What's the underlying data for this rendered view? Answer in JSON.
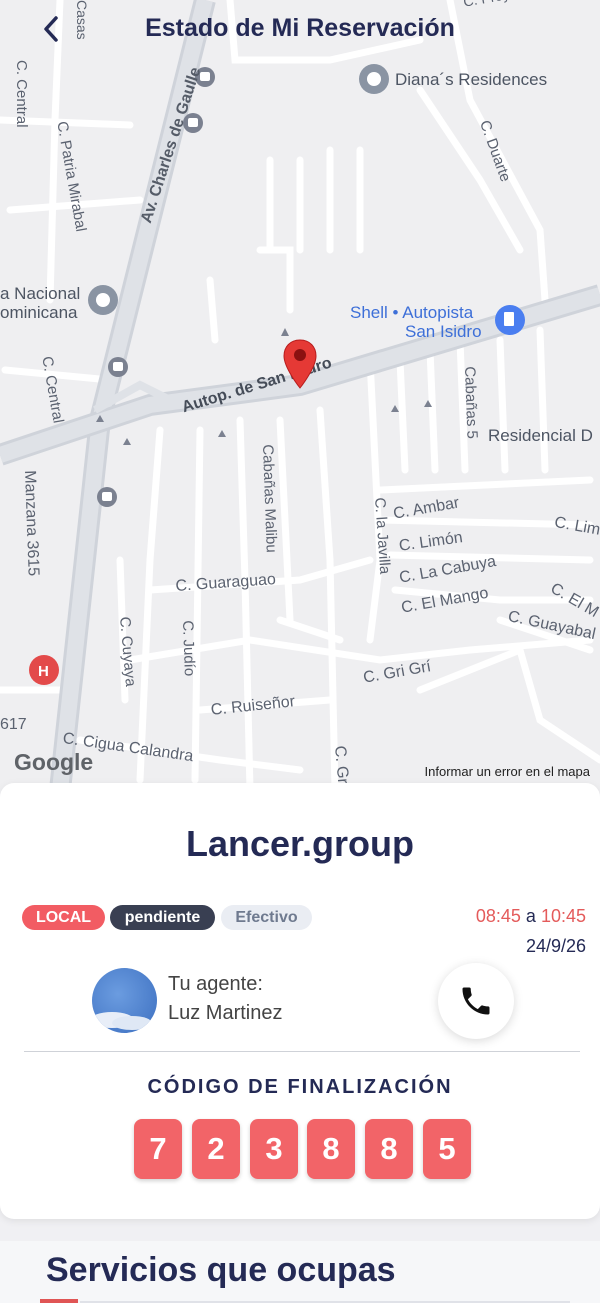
{
  "header": {
    "title": "Estado de Mi Reservación",
    "back_icon": "chevron-left-icon"
  },
  "map": {
    "streets": [
      "Av. Charles de Gaulle",
      "Autop. de San Isidro",
      "C. Central",
      "C. Patria Mirabal",
      "C. Duarte",
      "C. Central",
      "Manzana 3615",
      "Cabañas Malibu",
      "Cabañas 5",
      "C. la Javilla",
      "C. Ambar",
      "C. Limón",
      "C. La Cabuya",
      "C. El Mango",
      "C. Guayabal",
      "C. Guaraguao",
      "C. Cuyaya",
      "C. Judío",
      "C. Gri Grí",
      "C. Ruiseñor",
      "C. Cigua Calandra",
      "C. Lim",
      "C. El M",
      "C. Gr",
      "617",
      "Casas",
      "C. Proyecto"
    ],
    "places": [
      {
        "name": "Diana´s Residences",
        "icon": "poi-pin-icon"
      },
      {
        "name": "a Nacional",
        "icon": "poi-pin-icon"
      },
      {
        "name": "ominicana",
        "icon": ""
      },
      {
        "name": "Shell • Autopista",
        "icon": "gas-station-icon"
      },
      {
        "name": "San Isidro",
        "icon": ""
      },
      {
        "name": "Residencial D",
        "icon": ""
      }
    ],
    "attribution": "Google",
    "report_link": "Informar un error en el mapa",
    "marker_icon": "location-pin-icon",
    "marker_color": "#e53935"
  },
  "reservation": {
    "company": "Lancer.group",
    "badges": {
      "type": "LOCAL",
      "status": "pendiente",
      "payment": "Efectivo"
    },
    "time_start": "08:45",
    "time_sep": "a",
    "time_end": "10:45",
    "date": "24/9/26",
    "agent_label": "Tu agente:",
    "agent_name": "Luz Martinez",
    "call_icon": "phone-icon",
    "code_label": "CÓDIGO DE FINALIZACIÓN",
    "code_digits": [
      "7",
      "2",
      "3",
      "8",
      "8",
      "5"
    ]
  },
  "services": {
    "title": "Servicios que ocupas"
  },
  "colors": {
    "primary": "#242a55",
    "accent": "#f26468",
    "status_dark": "#393f52"
  }
}
